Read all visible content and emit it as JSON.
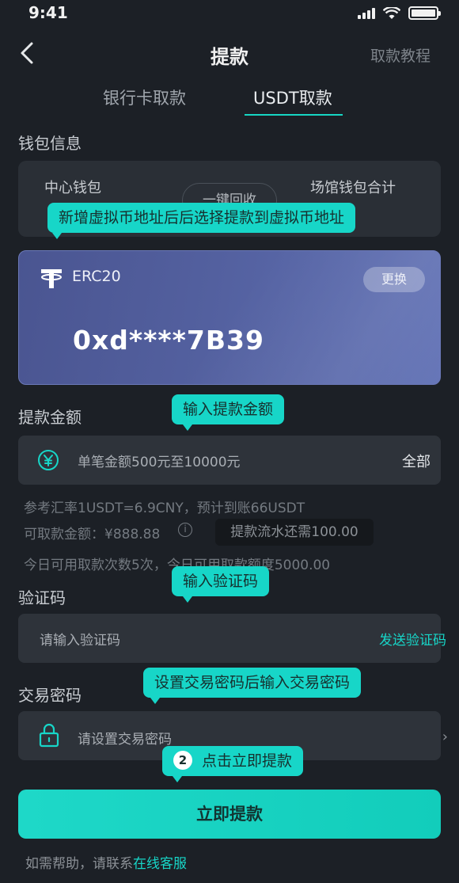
{
  "status_bar": {
    "time": "9:41"
  },
  "header": {
    "title": "提款",
    "tutorial": "取款教程"
  },
  "tabs": [
    {
      "label": "银行卡取款",
      "active": false
    },
    {
      "label": "USDT取款",
      "active": true
    }
  ],
  "wallet_info": {
    "label": "钱包信息",
    "center_wallet": "中心钱包",
    "venue_total": "场馆钱包合计",
    "recall_button": "一键回收"
  },
  "card": {
    "network": "ERC20",
    "change_button": "更换",
    "address": "0xd****7B39"
  },
  "amount": {
    "label": "提款金额",
    "placeholder": "单笔金额500元至10000元",
    "all_button": "全部"
  },
  "info": {
    "rate_line": "参考汇率1USDT=6.9CNY，预计到账66USDT",
    "withdrawable_line": "可取款金额：¥888.88",
    "turnover_tip": "提款流水还需100.00",
    "limit_line": "今日可用取款次数5次，今日可用取款额度5000.00"
  },
  "verify": {
    "label": "验证码",
    "placeholder": "请输入验证码",
    "send_button": "发送验证码"
  },
  "password": {
    "label": "交易密码",
    "placeholder": "请设置交易密码"
  },
  "submit": {
    "label": "立即提款"
  },
  "help": {
    "prefix": "如需帮助，请联系",
    "link": "在线客服"
  },
  "tooltips": {
    "address_tip": "新增虚拟币地址后后选择提款到虚拟币地址",
    "amount_tip": "输入提款金额",
    "code_tip": "输入验证码",
    "password_tip": "设置交易密码后输入交易密码",
    "submit_step": "2",
    "submit_tip": "点击立即提款"
  },
  "colors": {
    "accent": "#17d6c8",
    "background": "#1c2026",
    "card": "#53609f"
  }
}
